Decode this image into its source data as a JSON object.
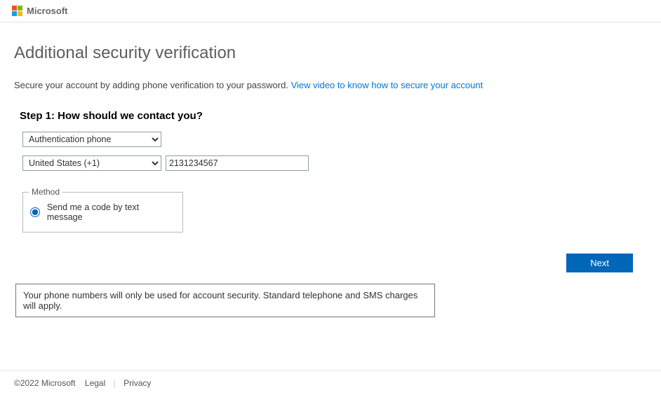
{
  "header": {
    "brand": "Microsoft"
  },
  "main": {
    "title": "Additional security verification",
    "subtitle_prefix": "Secure your account by adding phone verification to your password. ",
    "subtitle_link": "View video to know how to secure your account",
    "step_title": "Step 1: How should we contact you?",
    "method_select": {
      "selected": "Authentication phone",
      "options": [
        "Authentication phone"
      ]
    },
    "country_select": {
      "selected": "United States (+1)",
      "options": [
        "United States (+1)"
      ]
    },
    "phone_input": {
      "value": "2131234567",
      "placeholder": ""
    },
    "method_fieldset": {
      "legend": "Method",
      "radio_label": "Send me a code by text message",
      "radio_checked": true
    },
    "next_button": "Next",
    "notice": "Your phone numbers will only be used for account security. Standard telephone and SMS charges will apply."
  },
  "footer": {
    "copyright": "©2022 Microsoft",
    "legal": "Legal",
    "privacy": "Privacy"
  }
}
